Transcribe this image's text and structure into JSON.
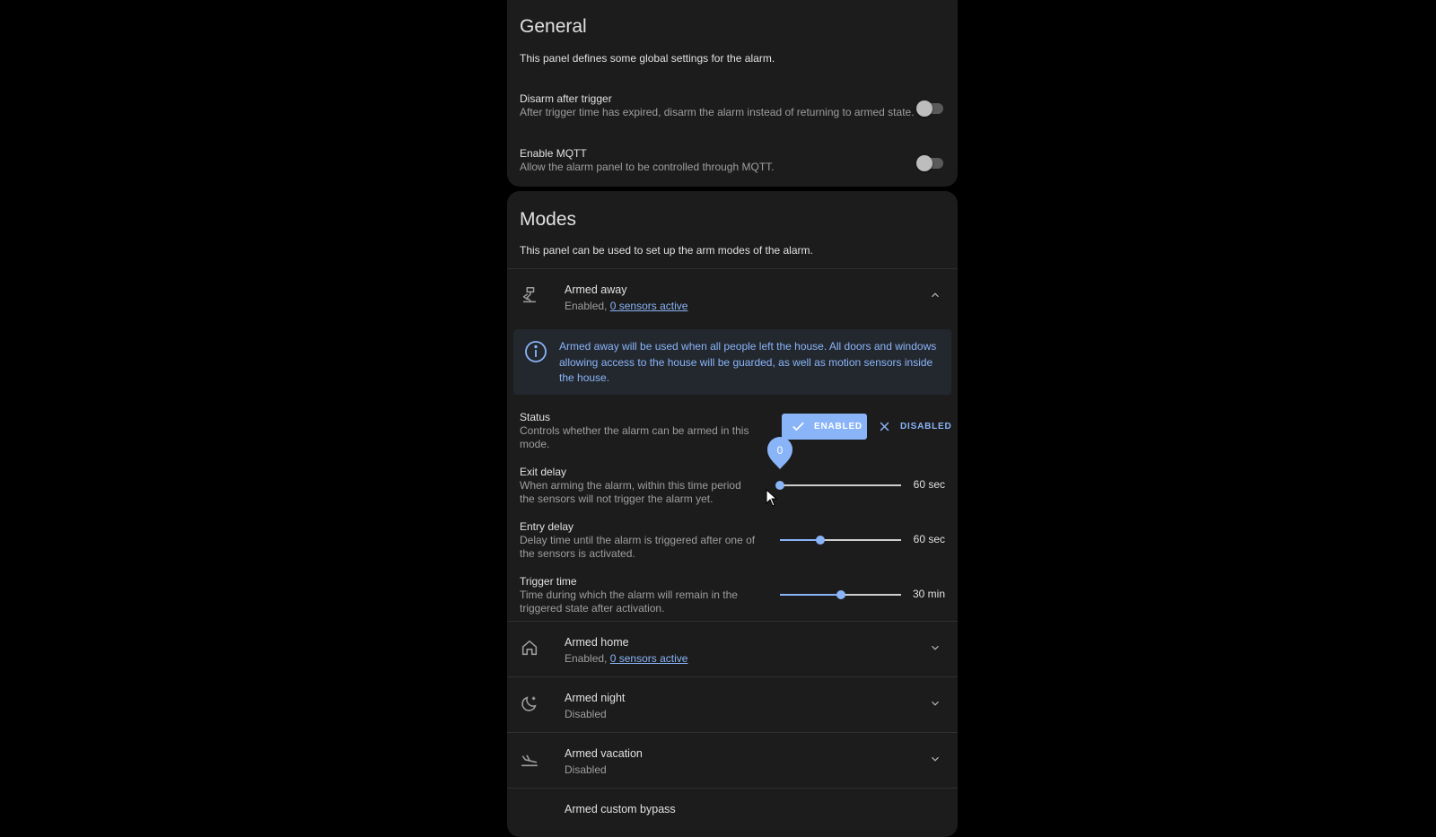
{
  "general": {
    "title": "General",
    "description": "This panel defines some global settings for the alarm.",
    "settings": [
      {
        "label": "Disarm after trigger",
        "description": "After trigger time has expired, disarm the alarm instead of returning to armed state.",
        "enabled": false
      },
      {
        "label": "Enable MQTT",
        "description": "Allow the alarm panel to be controlled through MQTT.",
        "enabled": false
      }
    ]
  },
  "modes": {
    "title": "Modes",
    "description": "This panel can be used to set up the arm modes of the alarm.",
    "armed_away": {
      "title": "Armed away",
      "status_prefix": "Enabled, ",
      "sensors_link": "0 sensors active",
      "icon": "walk-icon",
      "info": "Armed away will be used when all people left the house. All doors and windows allowing access to the house will be guarded, as well as motion sensors inside the house.",
      "status": {
        "label": "Status",
        "description": "Controls whether the alarm can be armed in this mode.",
        "enabled_label": "ENABLED",
        "disabled_label": "DISABLED",
        "selected": "enabled"
      },
      "exit_delay": {
        "label": "Exit delay",
        "description": "When arming the alarm, within this time period the sensors will not trigger the alarm yet.",
        "value_label": "60 sec",
        "position": 0,
        "tooltip": "0"
      },
      "entry_delay": {
        "label": "Entry delay",
        "description": "Delay time until the alarm is triggered after one of the sensors is activated.",
        "value_label": "60 sec",
        "position": 0.33
      },
      "trigger_time": {
        "label": "Trigger time",
        "description": "Time during which the alarm will remain in the triggered state after activation.",
        "value_label": "30 min",
        "position": 0.5
      }
    },
    "armed_home": {
      "title": "Armed home",
      "status_prefix": "Enabled, ",
      "sensors_link": "0 sensors active",
      "icon": "home-icon"
    },
    "armed_night": {
      "title": "Armed night",
      "status": "Disabled",
      "icon": "moon-icon"
    },
    "armed_vacation": {
      "title": "Armed vacation",
      "status": "Disabled",
      "icon": "airplane-landing-icon"
    },
    "armed_custom": {
      "title": "Armed custom bypass"
    }
  },
  "colors": {
    "accent": "#8ab4f8",
    "card": "#1c1c1c",
    "background": "#000000"
  }
}
